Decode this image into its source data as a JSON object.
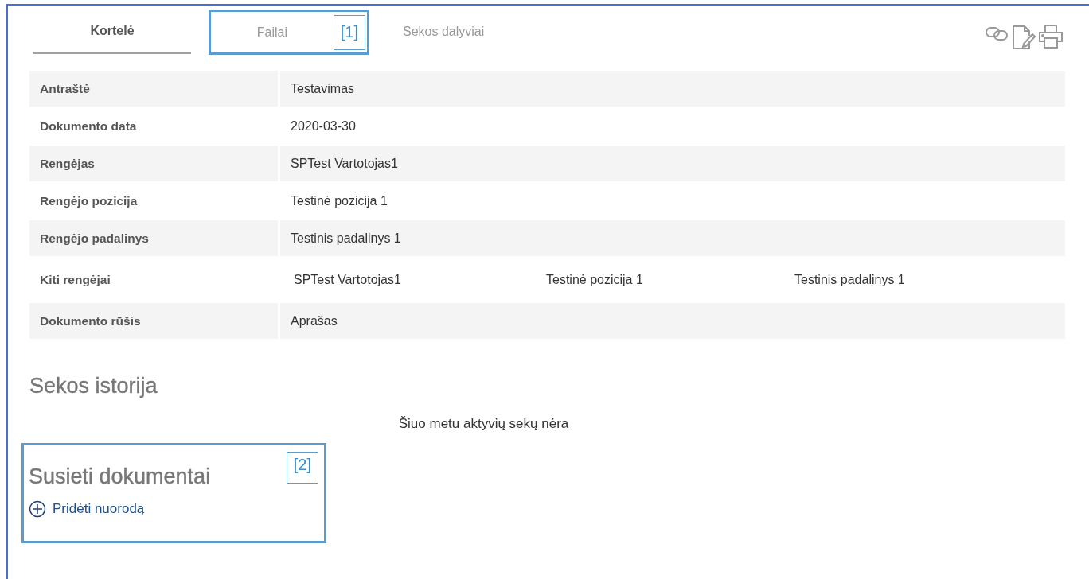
{
  "tabs": [
    {
      "label": "Kortelė",
      "selected": true
    },
    {
      "label": "Failai",
      "selected": false,
      "callout": "[1]"
    },
    {
      "label": "Sekos dalyviai",
      "selected": false
    }
  ],
  "fields": [
    {
      "label": "Antraštė",
      "values": [
        "Testavimas"
      ]
    },
    {
      "label": "Dokumento data",
      "values": [
        "2020-03-30"
      ]
    },
    {
      "label": "Rengėjas",
      "values": [
        "SPTest Vartotojas1"
      ]
    },
    {
      "label": "Rengėjo pozicija",
      "values": [
        "Testinė pozicija 1"
      ]
    },
    {
      "label": "Rengėjo padalinys",
      "values": [
        "Testinis padalinys 1"
      ]
    },
    {
      "label": "Kiti rengėjai",
      "values": [
        "SPTest Vartotojas1",
        "Testinė pozicija 1",
        "Testinis padalinys 1"
      ]
    },
    {
      "label": "Dokumento rūšis",
      "values": [
        "Aprašas"
      ]
    }
  ],
  "history": {
    "title": "Sekos istorija",
    "empty_message": "Šiuo metu aktyvių sekų nėra"
  },
  "linked_documents": {
    "title": "Susieti dokumentai",
    "callout": "[2]",
    "add_link": "Pridėti nuorodą"
  }
}
